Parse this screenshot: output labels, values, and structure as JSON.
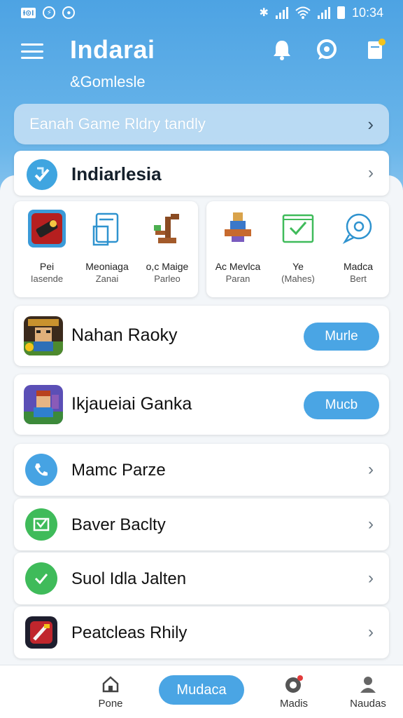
{
  "status_bar": {
    "left_badge": "Ɨ⊙I",
    "time": "10:34"
  },
  "header": {
    "title": "Indarai",
    "subtitle": "&Gomlesle"
  },
  "search_banner": {
    "text": "Eanah Game Rldry  tandly"
  },
  "section": {
    "title": "Indiarlesia"
  },
  "grid_a": [
    {
      "line1": "Pei",
      "line2": "Iasende",
      "icon": "toolbox-icon"
    },
    {
      "line1": "Meoniaga",
      "line2": "Zanai",
      "icon": "clipboard-icon"
    },
    {
      "line1": "o,c  Maige",
      "line2": "Parleo",
      "icon": "pixel-tree-icon"
    }
  ],
  "grid_b": [
    {
      "line1": "Ac  Mevlca",
      "line2": "Paran",
      "icon": "pixel-character-icon"
    },
    {
      "line1": "Ye",
      "line2": "(Mahes)",
      "icon": "checked-box-icon"
    },
    {
      "line1": "Madca",
      "line2": "Bert",
      "icon": "support-chat-icon"
    }
  ],
  "games": [
    {
      "title": "Nahan Raoky",
      "button": "Murle",
      "thumb": "pixel-warrior-game-icon"
    },
    {
      "title": "Ikjaueiai Ganka",
      "button": "Mucb",
      "thumb": "pixel-adventure-game-icon"
    }
  ],
  "list_items": [
    {
      "title": "Mamc Parze",
      "icon": "phone-icon",
      "color": "#46a3e3"
    },
    {
      "title": "Baver Baclty",
      "icon": "mail-check-icon",
      "color": "#3fbb5a"
    },
    {
      "title": "Suol Idla Jalten",
      "icon": "check-circle-icon",
      "color": "#3fbb5a"
    },
    {
      "title": "Peatcleas Rhily",
      "icon": "game-app-icon",
      "color": "#c0262d"
    }
  ],
  "bottom_nav": {
    "home": "Pone",
    "active": "Mudaca",
    "madis": "Madis",
    "naudas": "Naudas"
  },
  "colors": {
    "accent": "#4aa5e4",
    "header_top": "#4da3e3",
    "green": "#3fbb5a"
  }
}
